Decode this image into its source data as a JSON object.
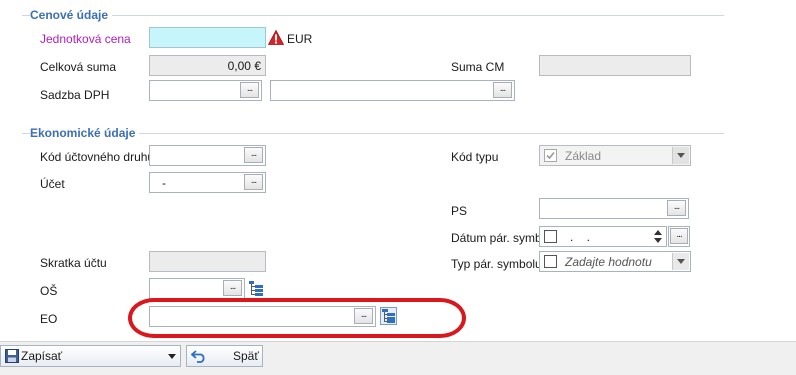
{
  "sections": {
    "price": {
      "title": "Cenové údaje"
    },
    "economic": {
      "title": "Ekonomické údaje"
    }
  },
  "price": {
    "unit_price_label": "Jednotková cena",
    "unit_price_value": "",
    "currency": "EUR",
    "total_label": "Celková suma",
    "total_value": "0,00 €",
    "sum_cm_label": "Suma CM",
    "sum_cm_value": "",
    "vat_label": "Sadzba DPH",
    "vat_value": "",
    "vat_desc_value": ""
  },
  "economic": {
    "account_type_code_label": "Kód účtovného druhu",
    "account_type_code_value": "",
    "type_code_label": "Kód typu",
    "type_code_value": "Základ",
    "account_label": "Účet",
    "account_value": "-",
    "ps_label": "PS",
    "ps_value": "",
    "pair_date_label": "Dátum pár. symb.",
    "pair_date_value": ". .",
    "account_short_label": "Skratka účtu",
    "account_short_value": "",
    "pair_type_label": "Typ pár. symbolu",
    "pair_type_placeholder": "Zadajte hodnotu",
    "os_label": "OŠ",
    "os_value": "",
    "eo_label": "EO",
    "eo_value": ""
  },
  "dots_label": "...",
  "footer": {
    "save_label": "Zapísať",
    "back_label": "Späť"
  },
  "colors": {
    "section_title": "#3b6fb6",
    "required_label": "#b01dbf",
    "required_field": "#c6f6fb",
    "highlight": "#d9171d"
  },
  "icons": {
    "warning": "warning-icon",
    "tree": "tree-icon",
    "save": "floppy-disk-icon",
    "back": "undo-arrow-icon"
  }
}
